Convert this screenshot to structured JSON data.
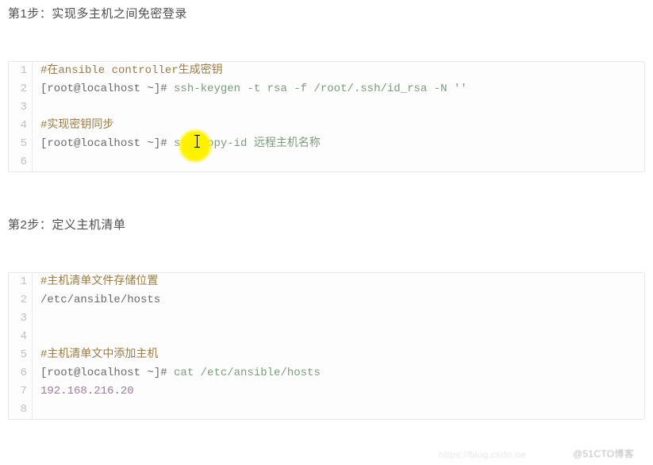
{
  "step1_title": "第1步：实现多主机之间免密登录",
  "step2_title": "第2步：定义主机清单",
  "block1": {
    "lines": [
      {
        "n": "1",
        "segments": [
          {
            "cls": "comment",
            "t": "#在ansible controller生成密钥"
          }
        ]
      },
      {
        "n": "2",
        "segments": [
          {
            "cls": "cmdtext",
            "t": "[root@localhost ~]# "
          },
          {
            "cls": "kwtext",
            "t": "ssh-keygen -t rsa -f /root/.ssh/id_rsa -N ''"
          }
        ]
      },
      {
        "n": "3",
        "segments": []
      },
      {
        "n": "4",
        "segments": [
          {
            "cls": "comment",
            "t": "#实现密钥同步"
          }
        ]
      },
      {
        "n": "5",
        "segments": [
          {
            "cls": "cmdtext",
            "t": "[root@localhost ~]# "
          },
          {
            "cls": "kwtext",
            "t": "ssh-copy-id 远程主机名称"
          }
        ]
      },
      {
        "n": "6",
        "segments": []
      }
    ]
  },
  "block2": {
    "lines": [
      {
        "n": "1",
        "segments": [
          {
            "cls": "comment",
            "t": "#主机清单文件存储位置"
          }
        ]
      },
      {
        "n": "2",
        "segments": [
          {
            "cls": "cmdtext",
            "t": "/etc/ansible/hosts"
          }
        ]
      },
      {
        "n": "3",
        "segments": []
      },
      {
        "n": "4",
        "segments": []
      },
      {
        "n": "5",
        "segments": [
          {
            "cls": "comment",
            "t": "#主机清单文中添加主机"
          }
        ]
      },
      {
        "n": "6",
        "segments": [
          {
            "cls": "cmdtext",
            "t": "[root@localhost ~]# "
          },
          {
            "cls": "kwtext",
            "t": "cat /etc/ansible/hosts"
          }
        ]
      },
      {
        "n": "7",
        "segments": [
          {
            "cls": "numtext",
            "t": "192"
          },
          {
            "cls": "dottext",
            "t": "."
          },
          {
            "cls": "numtext",
            "t": "168"
          },
          {
            "cls": "dottext",
            "t": "."
          },
          {
            "cls": "numtext",
            "t": "216"
          },
          {
            "cls": "dottext",
            "t": "."
          },
          {
            "cls": "numtext",
            "t": "20"
          }
        ]
      },
      {
        "n": "8",
        "segments": []
      }
    ]
  },
  "watermark_left": "https://blog.csdn.ne",
  "watermark_right": "@51CTO博客"
}
